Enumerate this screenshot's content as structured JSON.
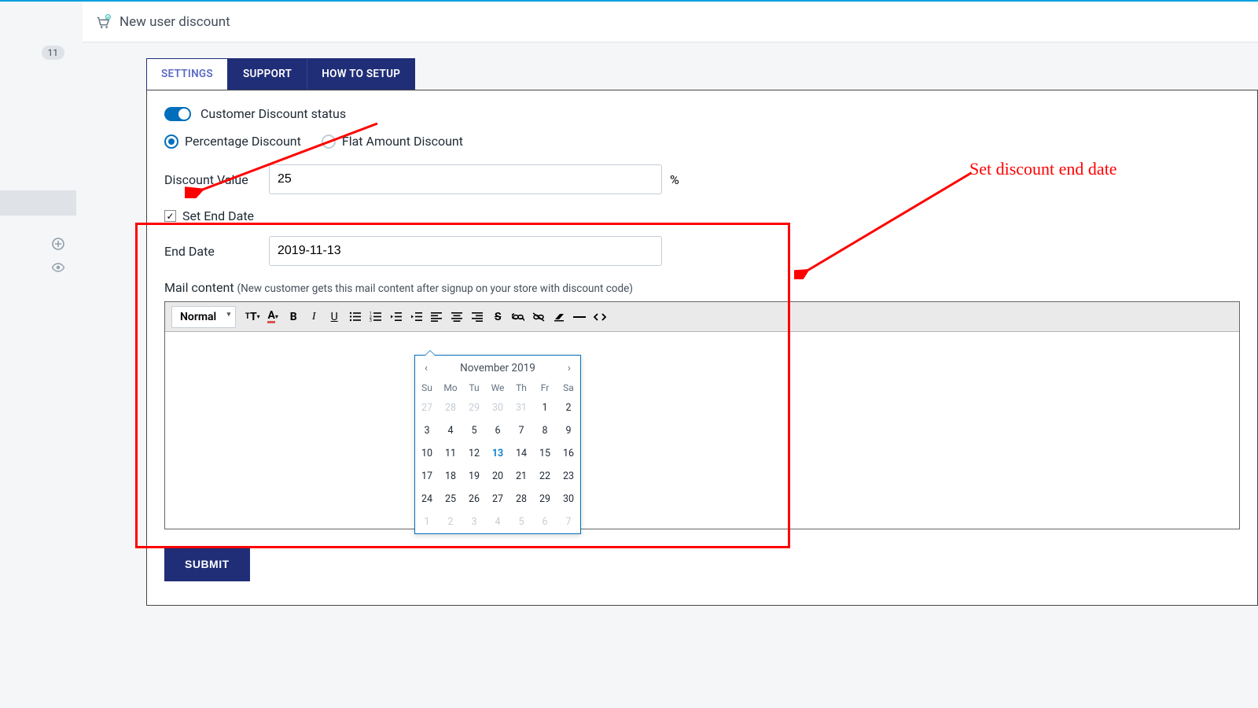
{
  "header": {
    "title": "New user discount"
  },
  "sidebar": {
    "badge": "11"
  },
  "tabs": [
    {
      "label": "SETTINGS",
      "active": true
    },
    {
      "label": "SUPPORT",
      "active": false
    },
    {
      "label": "HOW TO SETUP",
      "active": false
    }
  ],
  "status": {
    "label": "Customer Discount status",
    "enabled": true
  },
  "discount_type": {
    "percentage_label": "Percentage Discount",
    "flat_label": "Flat Amount Discount",
    "selected": "percentage"
  },
  "discount_value": {
    "label": "Discount Value",
    "value": "25",
    "suffix": "%"
  },
  "set_end_date": {
    "label": "Set End Date",
    "checked": true
  },
  "end_date": {
    "label": "End Date",
    "value": "2019-11-13"
  },
  "mail": {
    "label": "Mail content",
    "hint": "(New customer gets this mail content after signup on your store with discount code)",
    "toolbar": {
      "normal": "Normal"
    }
  },
  "submit_label": "SUBMIT",
  "datepicker": {
    "month_label": "November 2019",
    "dows": [
      "Su",
      "Mo",
      "Tu",
      "We",
      "Th",
      "Fr",
      "Sa"
    ],
    "cells": [
      {
        "n": "27",
        "m": true
      },
      {
        "n": "28",
        "m": true
      },
      {
        "n": "29",
        "m": true
      },
      {
        "n": "30",
        "m": true
      },
      {
        "n": "31",
        "m": true
      },
      {
        "n": "1"
      },
      {
        "n": "2"
      },
      {
        "n": "3"
      },
      {
        "n": "4"
      },
      {
        "n": "5"
      },
      {
        "n": "6"
      },
      {
        "n": "7"
      },
      {
        "n": "8"
      },
      {
        "n": "9"
      },
      {
        "n": "10"
      },
      {
        "n": "11"
      },
      {
        "n": "12"
      },
      {
        "n": "13",
        "sel": true
      },
      {
        "n": "14"
      },
      {
        "n": "15"
      },
      {
        "n": "16"
      },
      {
        "n": "17"
      },
      {
        "n": "18"
      },
      {
        "n": "19"
      },
      {
        "n": "20"
      },
      {
        "n": "21"
      },
      {
        "n": "22"
      },
      {
        "n": "23"
      },
      {
        "n": "24"
      },
      {
        "n": "25"
      },
      {
        "n": "26"
      },
      {
        "n": "27"
      },
      {
        "n": "28"
      },
      {
        "n": "29"
      },
      {
        "n": "30"
      },
      {
        "n": "1",
        "m": true
      },
      {
        "n": "2",
        "m": true
      },
      {
        "n": "3",
        "m": true
      },
      {
        "n": "4",
        "m": true
      },
      {
        "n": "5",
        "m": true
      },
      {
        "n": "6",
        "m": true
      },
      {
        "n": "7",
        "m": true
      }
    ]
  },
  "annotations": {
    "end_date_callout": "Set discount end date"
  }
}
